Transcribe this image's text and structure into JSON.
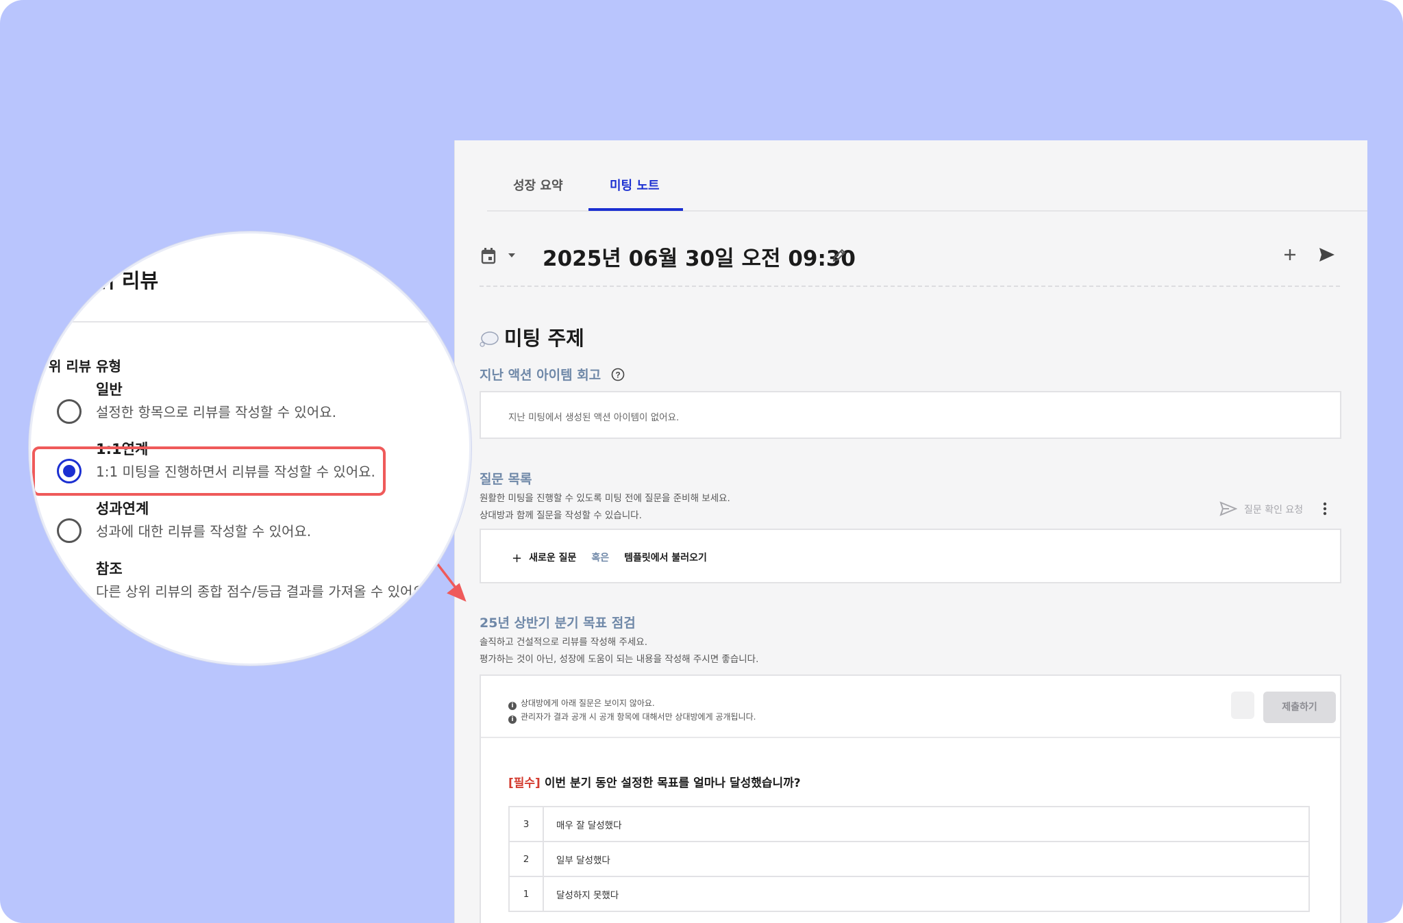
{
  "tabs": [
    {
      "label": "성장 요약",
      "active": false
    },
    {
      "label": "미팅 노트",
      "active": true
    }
  ],
  "meeting": {
    "date": "2025년 06월 30일 오전 09:30"
  },
  "topic": {
    "title": "미팅 주제"
  },
  "action_items": {
    "title": "지난 액션 아이템 회고",
    "empty_text": "지난 미팅에서 생성된 액션 아이템이 없어요."
  },
  "questions": {
    "title": "질문 목록",
    "desc1": "원활한 미팅을 진행할 수 있도록 미팅 전에 질문을 준비해 보세요.",
    "desc2": "상대방과 함께 질문을 작성할 수 있습니다.",
    "request_label": "질문 확인 요청",
    "new_question": "새로운 질문",
    "or_label": "혹은",
    "template_label": "템플릿에서 불러오기"
  },
  "review": {
    "title": "25년 상반기 분기 목표 점검",
    "desc1": "솔직하고 건설적으로 리뷰를 작성해 주세요.",
    "desc2": "평가하는 것이 아닌, 성장에 도움이 되는 내용을 작성해 주시면 좋습니다.",
    "note1": "상대방에게 아래 질문은 보이지 않아요.",
    "note2": "관리자가 결과 공개 시 공개 항목에 대해서만 상대방에게 공개됩니다.",
    "submit_label": "제출하기",
    "required_tag": "[필수]",
    "question": "이번 분기 동안 설정한 목표를 얼마나 달성했습니까?",
    "options": [
      {
        "score": "3",
        "label": "매우 잘 달성했다"
      },
      {
        "score": "2",
        "label": "일부 달성했다"
      },
      {
        "score": "1",
        "label": "달성하지 못했다"
      }
    ]
  },
  "magnifier": {
    "title": "위 리뷰",
    "group_label": "위 리뷰 유형",
    "options": [
      {
        "label": "일반",
        "desc": "설정한 항목으로 리뷰를 작성할 수 있어요.",
        "selected": false
      },
      {
        "label": "1:1연계",
        "desc": "1:1 미팅을 진행하면서 리뷰를 작성할 수 있어요.",
        "selected": true
      },
      {
        "label": "성과연계",
        "desc": "성과에 대한 리뷰를 작성할 수 있어요.",
        "selected": false
      },
      {
        "label": "참조",
        "desc": "다른 상위 리뷰의 종합 점수/등급 결과를 가져올 수 있어요",
        "selected": false
      }
    ]
  },
  "colors": {
    "background": "#b9c5fd",
    "accent": "#1b2fd1",
    "section_title": "#6f88a8",
    "required": "#d33b2f",
    "highlight": "#ef5a5a"
  }
}
